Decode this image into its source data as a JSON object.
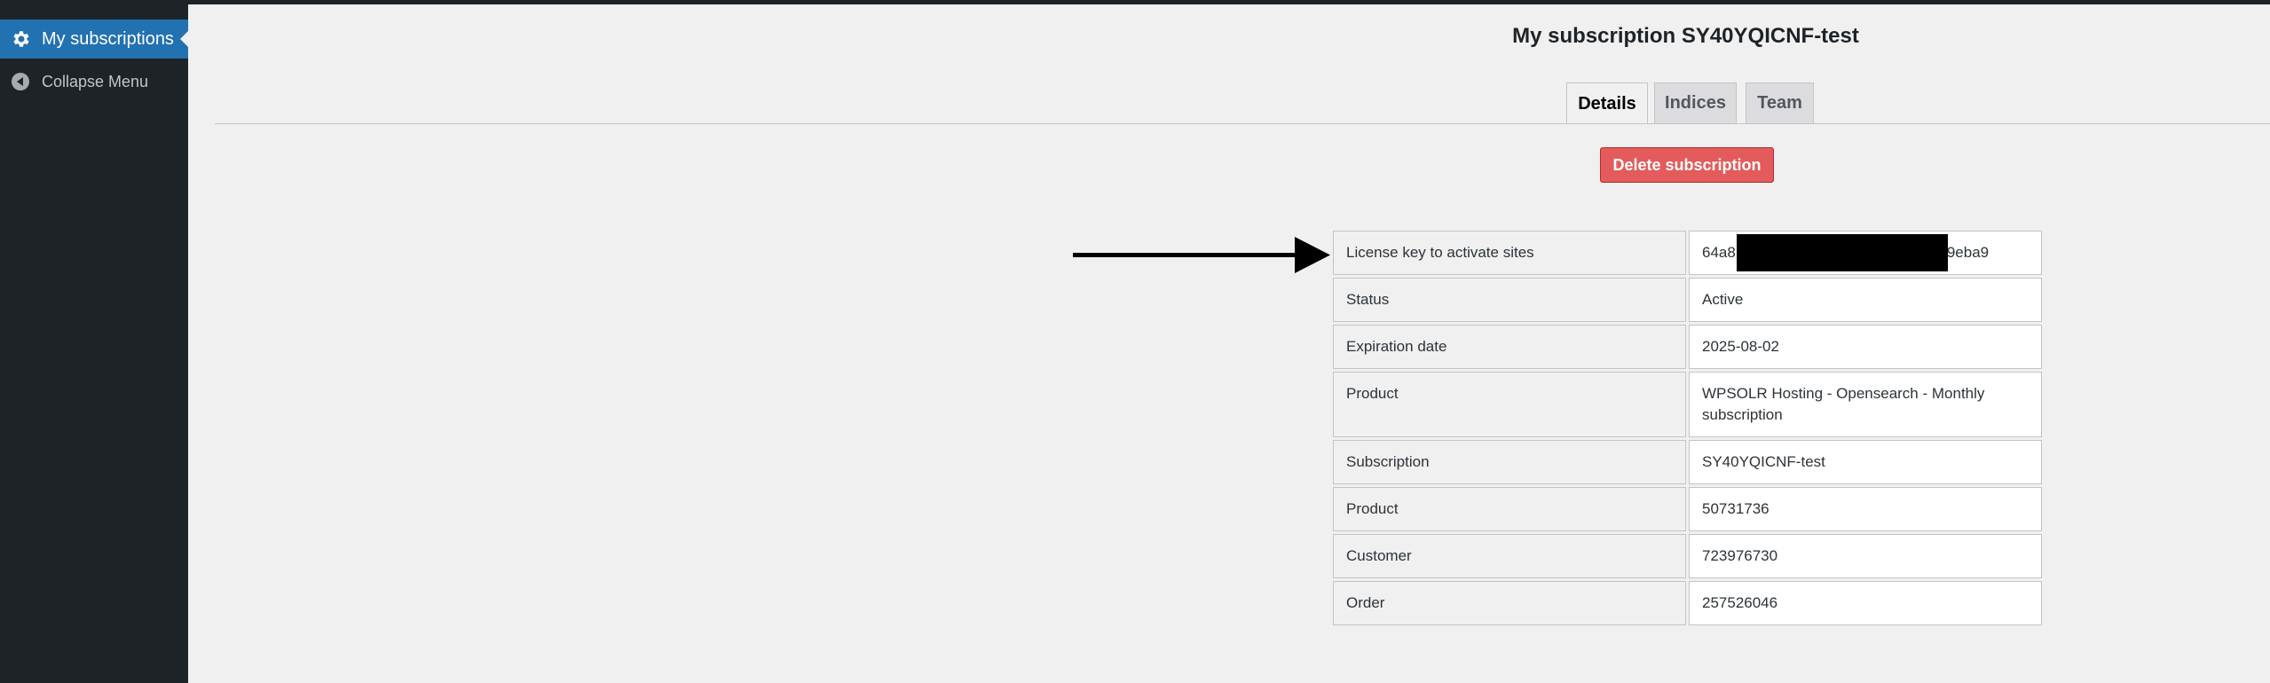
{
  "sidebar": {
    "items": [
      {
        "label": "My subscriptions",
        "icon": "gear-icon",
        "active": true
      },
      {
        "label": "Collapse Menu",
        "icon": "collapse-arrow-icon",
        "active": false
      }
    ]
  },
  "page": {
    "title": "My subscription SY40YQICNF-test"
  },
  "tabs": [
    {
      "label": "Details",
      "active": true
    },
    {
      "label": "Indices",
      "active": false
    },
    {
      "label": "Team",
      "active": false
    }
  ],
  "actions": {
    "delete_label": "Delete subscription"
  },
  "details": {
    "rows": [
      {
        "key": "License key to activate sites",
        "value_start": "64a8",
        "value_end": "9eba9",
        "redacted": true
      },
      {
        "key": "Status",
        "value": "Active"
      },
      {
        "key": "Expiration date",
        "value": "2025-08-02"
      },
      {
        "key": "Product",
        "value": "WPSOLR Hosting - Opensearch - Monthly subscription"
      },
      {
        "key": "Subscription",
        "value": "SY40YQICNF-test"
      },
      {
        "key": "Product",
        "value": "50731736"
      },
      {
        "key": "Customer",
        "value": "723976730"
      },
      {
        "key": "Order",
        "value": "257526046"
      }
    ]
  },
  "colors": {
    "sidebar_bg": "#1d2327",
    "active_menu": "#2271b1",
    "delete_button": "#e35b5b",
    "page_bg": "#f0f0f1"
  }
}
